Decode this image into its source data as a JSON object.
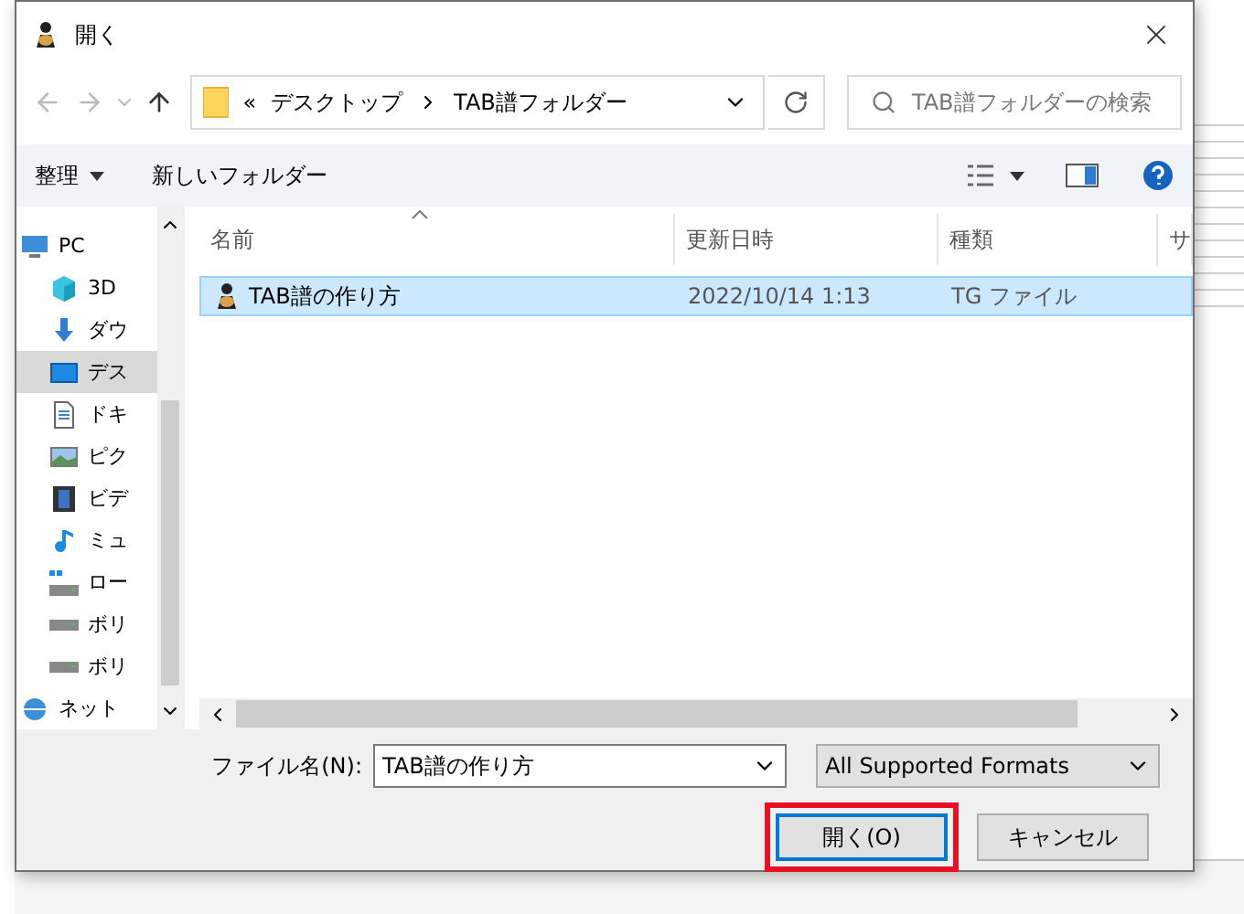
{
  "dialog": {
    "title": "開く"
  },
  "navigation": {
    "breadcrumb_prefix": "«",
    "path": [
      "デスクトップ",
      "TAB譜フォルダー"
    ],
    "search": {
      "placeholder": "TAB譜フォルダーの検索"
    }
  },
  "toolbar": {
    "organize": "整理",
    "new_folder": "新しいフォルダー"
  },
  "sidebar": {
    "items": [
      {
        "label": "PC",
        "kind": "pc",
        "selected": false,
        "children": [
          {
            "label": "3D",
            "kind": "cube",
            "selected": false
          },
          {
            "label": "ダウ",
            "kind": "download",
            "selected": false
          },
          {
            "label": "デス",
            "kind": "desktop",
            "selected": true
          },
          {
            "label": "ドキ",
            "kind": "document",
            "selected": false
          },
          {
            "label": "ピク",
            "kind": "pictures",
            "selected": false
          },
          {
            "label": "ビデ",
            "kind": "video",
            "selected": false
          },
          {
            "label": "ミュ",
            "kind": "music",
            "selected": false
          },
          {
            "label": "ロー",
            "kind": "local-drive",
            "selected": false
          },
          {
            "label": "ボリ",
            "kind": "drive",
            "selected": false
          },
          {
            "label": "ボリ",
            "kind": "drive",
            "selected": false
          }
        ]
      },
      {
        "label": "ネット",
        "kind": "network",
        "selected": false
      }
    ]
  },
  "table": {
    "columns": [
      "名前",
      "更新日時",
      "種類",
      "サ"
    ],
    "rows": [
      {
        "cells": [
          "TAB譜の作り方",
          "2022/10/14 1:13",
          "TG ファイル"
        ],
        "selected": true
      }
    ]
  },
  "footer": {
    "filename_label": "ファイル名(N):",
    "filename": "TAB譜の作り方",
    "file_type": "All Supported Formats",
    "buttons": [
      {
        "label": "開く(O)",
        "kind": "primary",
        "highlighted": true
      },
      {
        "label": "キャンセル",
        "kind": "secondary",
        "highlighted": false
      }
    ]
  }
}
